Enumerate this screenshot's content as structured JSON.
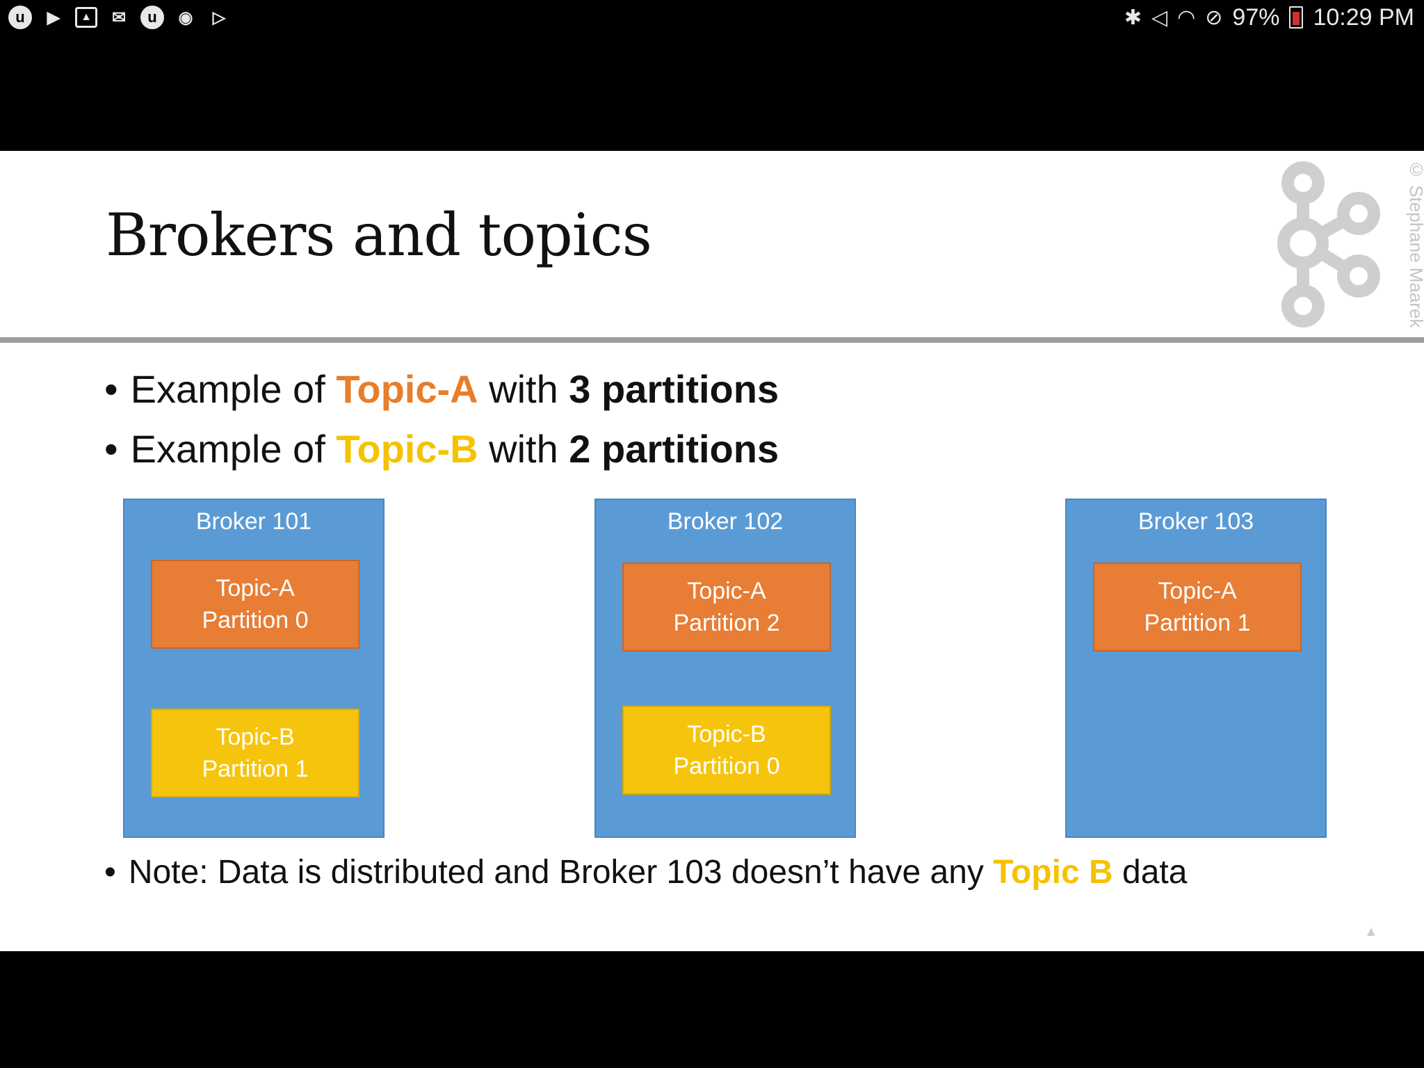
{
  "statusbar": {
    "left_icons": [
      "udemy-icon",
      "youtube-icon",
      "gallery-icon",
      "gmail-icon",
      "udemy-icon",
      "sync-icon",
      "play-store-icon"
    ],
    "right_icons": [
      "bluetooth-icon",
      "mute-icon",
      "wifi-icon",
      "do-not-disturb-icon"
    ],
    "battery": "97%",
    "time": "10:29 PM"
  },
  "slide": {
    "title": "Brokers and topics",
    "watermark": "© Stephane Maarek",
    "bullets": [
      {
        "prefix": "Example of ",
        "topic": "Topic-A",
        "mid": " with ",
        "count": "3 partitions"
      },
      {
        "prefix": "Example of ",
        "topic": "Topic-B",
        "mid": " with ",
        "count": "2 partitions"
      }
    ],
    "brokers": [
      {
        "label": "Broker 101",
        "a_topic": "Topic-A",
        "a_part": "Partition 0",
        "b_topic": "Topic-B",
        "b_part": "Partition 1"
      },
      {
        "label": "Broker 102",
        "a_topic": "Topic-A",
        "a_part": "Partition 2",
        "b_topic": "Topic-B",
        "b_part": "Partition 0"
      },
      {
        "label": "Broker 103",
        "a_topic": "Topic-A",
        "a_part": "Partition 1"
      }
    ],
    "note": {
      "prefix": "Note: Data is distributed and Broker 103 doesn’t have any ",
      "highlight": "Topic B",
      "suffix": " data"
    },
    "colors": {
      "broker": "#5b9bd5",
      "topic_a": "#e87d35",
      "topic_b": "#f6c40c"
    }
  }
}
